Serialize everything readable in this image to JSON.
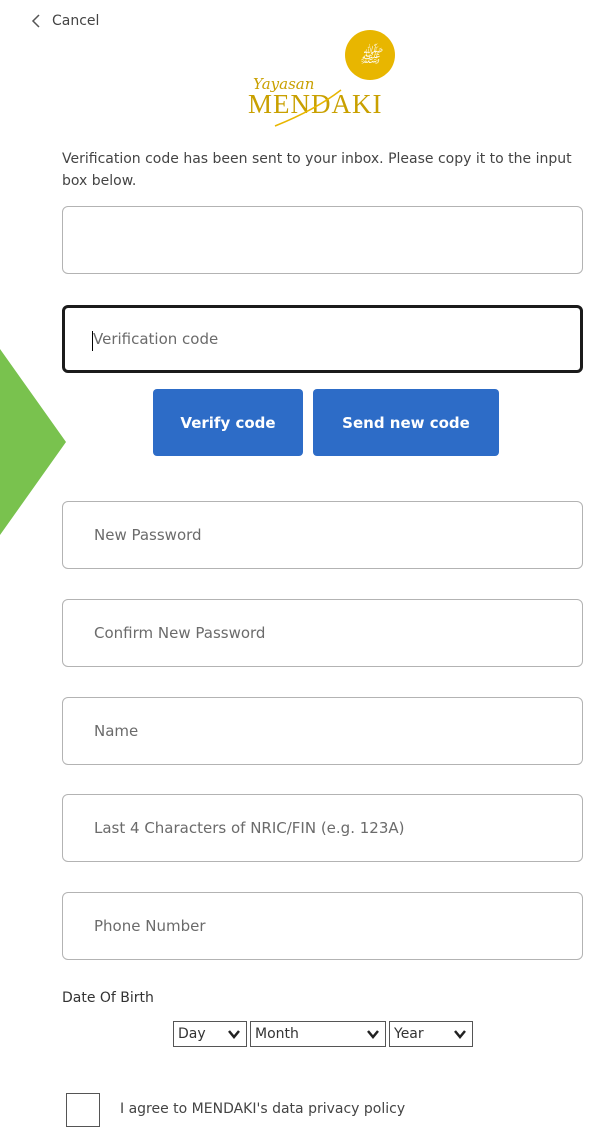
{
  "header": {
    "cancel_label": "Cancel"
  },
  "logo": {
    "script_text": "Yayasan",
    "word_text": "MENDAKI",
    "gold_color": "#e8b600"
  },
  "instructions": "Verification code has been sent to your inbox. Please copy it to the input box below.",
  "email_field": {
    "value": "",
    "placeholder": ""
  },
  "verification_field": {
    "value": "",
    "placeholder": "Verification code"
  },
  "buttons": {
    "verify_label": "Verify code",
    "send_new_label": "Send new code",
    "color": "#2d6cc7"
  },
  "new_password": {
    "placeholder": "New Password"
  },
  "confirm_password": {
    "placeholder": "Confirm New Password"
  },
  "name_field": {
    "placeholder": "Name"
  },
  "nric_field": {
    "placeholder": "Last 4 Characters of NRIC/FIN (e.g. 123A)"
  },
  "phone_field": {
    "placeholder": "Phone Number"
  },
  "dob": {
    "label": "Date Of Birth",
    "day": "Day",
    "month": "Month",
    "year": "Year"
  },
  "privacy": {
    "label": "I agree to MENDAKI's data privacy policy"
  },
  "accent_arrow_color": "#79c24e"
}
